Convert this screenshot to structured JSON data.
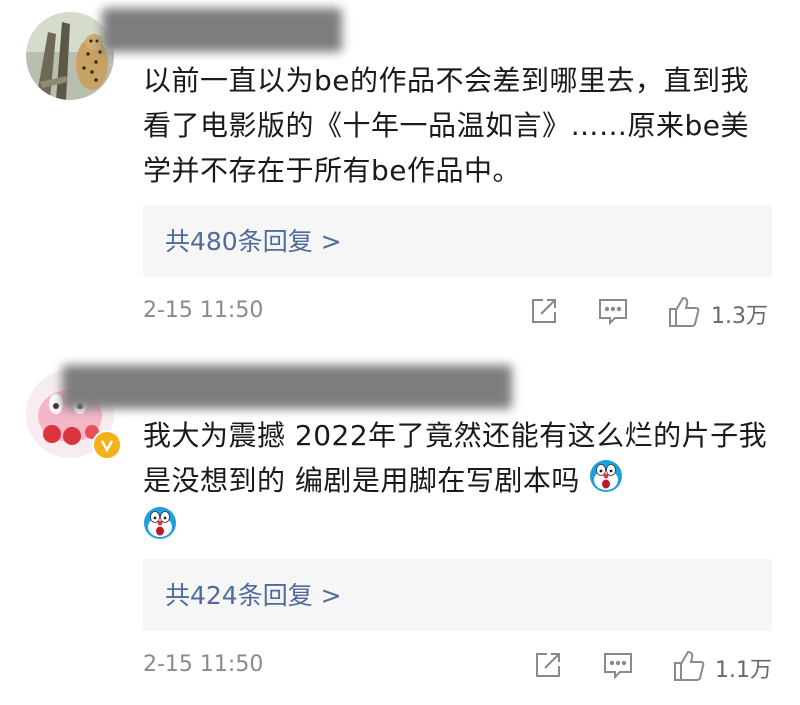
{
  "comments": [
    {
      "text": "以前一直以为be的作品不会差到哪里去，直到我看了电影版的《十年一品温如言》……原来be美学并不存在于所有be作品中。",
      "replies_label": "共480条回复 >",
      "time": "2-15 11:50",
      "likes": "1.3万"
    },
    {
      "text": "我大为震撼 2022年了竟然还能有这么烂的片子我是没想到的 编剧是用脚在写剧本吗",
      "replies_label": "共424条回复 >",
      "time": "2-15 11:50",
      "likes": "1.1万"
    }
  ],
  "icons": {
    "share": "share-icon",
    "comment": "comment-icon",
    "like": "thumbs-up-icon",
    "emoji": "doraemon-shocked-emoji",
    "verified": "verified-badge-icon"
  },
  "colors": {
    "link": "#4f6a9b",
    "reply_bg": "#f6f6f6",
    "meta": "#8a8a8a",
    "badge": "#f4b11b"
  }
}
